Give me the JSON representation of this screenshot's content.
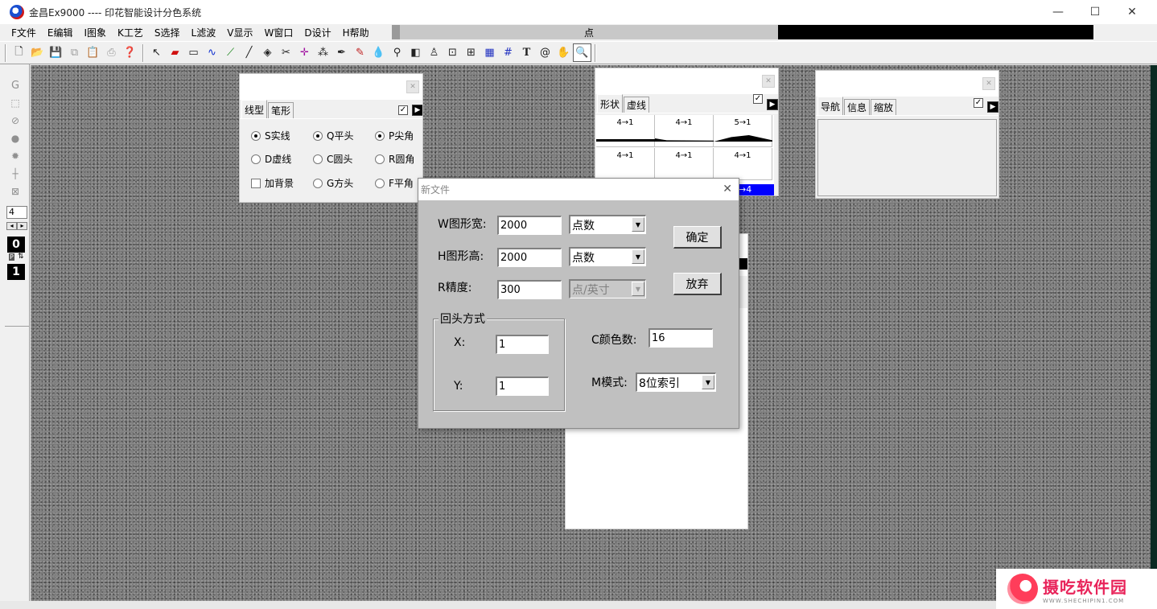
{
  "window": {
    "title": "金昌Ex9000 ---- 印花智能设计分色系统",
    "minimize": "—",
    "maximize": "☐",
    "close": "✕"
  },
  "menu": [
    "F文件",
    "E编辑",
    "I图象",
    "K工艺",
    "S选择",
    "L滤波",
    "V显示",
    "W窗口",
    "D设计",
    "H帮助"
  ],
  "status": {
    "unit": "点"
  },
  "toolbar_icons": [
    "new-file-icon",
    "open-icon",
    "save-icon",
    "copy-icon",
    "paste-icon",
    "print-icon",
    "help-icon",
    "arrow-select-icon",
    "eraser-icon",
    "rectangle-icon",
    "brush-icon",
    "curve-icon",
    "line-icon",
    "fill-icon",
    "scissors-icon",
    "crosshair-icon",
    "spray-icon",
    "pen-icon",
    "pencil-icon",
    "drop-icon",
    "magic-wand-icon",
    "gradient-icon",
    "stamp-icon",
    "frame-icon",
    "frame2-icon",
    "grid-icon",
    "hash-icon",
    "text-icon",
    "spiral-icon",
    "hand-icon",
    "zoom-icon"
  ],
  "toolbox": {
    "value": "4",
    "num_top": "0",
    "num_bottom": "1",
    "p_label": "P"
  },
  "line_panel": {
    "tabs": [
      "线型",
      "笔形"
    ],
    "check": "✓",
    "options": {
      "solid": "S实线",
      "dashed": "D虚线",
      "background": "加背景",
      "flat_head": "Q平头",
      "round_head": "C圆头",
      "square_head": "G方头",
      "sharp_corner": "P尖角",
      "round_corner": "R圆角",
      "flat_corner": "F平角"
    }
  },
  "shape_panel": {
    "tabs": [
      "形状",
      "虚线"
    ],
    "cells": [
      "4→1",
      "4→1",
      "5→1",
      "4→1",
      "4→1",
      "4→1"
    ],
    "selected_cell": "→4"
  },
  "nav_panel": {
    "tabs": [
      "导航",
      "信息",
      "缩放"
    ]
  },
  "dialog": {
    "title": "新文件",
    "width_label": "W图形宽:",
    "width_value": "2000",
    "width_unit": "点数",
    "height_label": "H图形高:",
    "height_value": "2000",
    "height_unit": "点数",
    "resolution_label": "R精度:",
    "resolution_value": "300",
    "resolution_unit": "点/英寸",
    "ok": "确定",
    "cancel": "放弃",
    "repeat_group": "回头方式",
    "x_label": "X:",
    "x_value": "1",
    "y_label": "Y:",
    "y_value": "1",
    "colors_label": "C颜色数:",
    "colors_value": "16",
    "mode_label": "M模式:",
    "mode_value": "8位索引"
  },
  "watermark": {
    "title": "摄吃软件园",
    "subtitle": "WWW.SHECHIPIN1.COM"
  }
}
